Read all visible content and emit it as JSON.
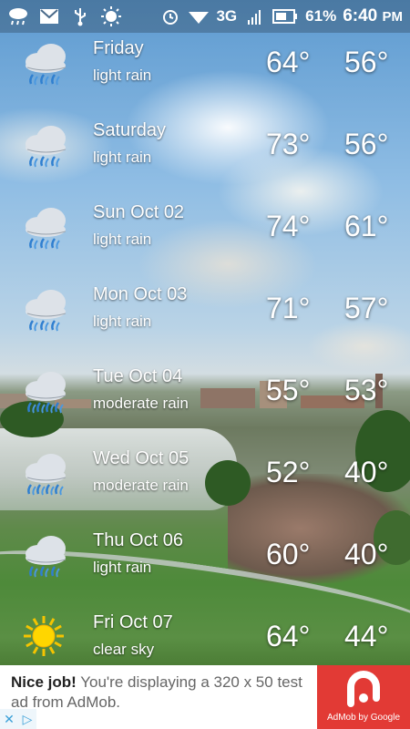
{
  "status_bar": {
    "network": "3G",
    "battery": "61%",
    "time": "6:40",
    "ampm": "PM",
    "icons": [
      "cloud-rain-icon",
      "gmail-icon",
      "usb-icon",
      "sun-icon",
      "alarm-icon",
      "wifi-icon",
      "signal-icon",
      "battery-icon"
    ]
  },
  "forecast": [
    {
      "day": "Friday",
      "desc": "light rain",
      "hi": "64°",
      "lo": "56°",
      "icon": "rain-cloud-icon"
    },
    {
      "day": "Saturday",
      "desc": "light rain",
      "hi": "73°",
      "lo": "56°",
      "icon": "rain-cloud-icon"
    },
    {
      "day": "Sun Oct 02",
      "desc": "light rain",
      "hi": "74°",
      "lo": "61°",
      "icon": "rain-cloud-icon"
    },
    {
      "day": "Mon Oct 03",
      "desc": "light rain",
      "hi": "71°",
      "lo": "57°",
      "icon": "rain-cloud-icon"
    },
    {
      "day": "Tue Oct 04",
      "desc": "moderate rain",
      "hi": "55°",
      "lo": "53°",
      "icon": "heavy-rain-cloud-icon"
    },
    {
      "day": "Wed Oct 05",
      "desc": "moderate rain",
      "hi": "52°",
      "lo": "40°",
      "icon": "heavy-rain-cloud-icon"
    },
    {
      "day": "Thu Oct 06",
      "desc": "light rain",
      "hi": "60°",
      "lo": "40°",
      "icon": "rain-cloud-icon"
    },
    {
      "day": "Fri Oct 07",
      "desc": "clear sky",
      "hi": "64°",
      "lo": "44°",
      "icon": "sun-icon"
    }
  ],
  "ad": {
    "headline": "Nice job!",
    "message": "You're displaying a 320 x 50 test ad from AdMob.",
    "brand": "AdMob by Google",
    "brand_color": "#e23a35"
  }
}
